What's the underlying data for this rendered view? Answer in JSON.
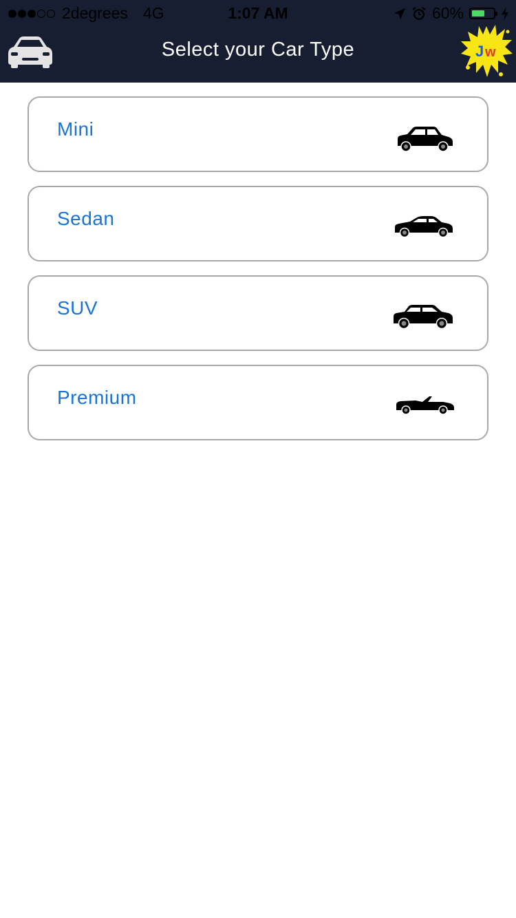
{
  "status_bar": {
    "signal_filled": 3,
    "signal_total": 5,
    "carrier": "2degrees",
    "network": "4G",
    "time": "1:07 AM",
    "battery_percent": "60%",
    "battery_level": 0.6,
    "icons": [
      "location-arrow-icon",
      "alarm-icon",
      "battery-icon",
      "charging-bolt-icon"
    ]
  },
  "nav": {
    "title": "Select your Car Type",
    "left_icon": "car-icon",
    "logo_text": "Jw"
  },
  "car_types": [
    {
      "label": "Mini",
      "icon": "hatchback-icon"
    },
    {
      "label": "Sedan",
      "icon": "sedan-icon"
    },
    {
      "label": "SUV",
      "icon": "suv-icon"
    },
    {
      "label": "Premium",
      "icon": "convertible-icon"
    }
  ],
  "colors": {
    "nav_background": "#171e31",
    "label_blue": "#1a73d6",
    "card_border": "#a8a8a8",
    "logo_yellow": "#f7e514"
  }
}
